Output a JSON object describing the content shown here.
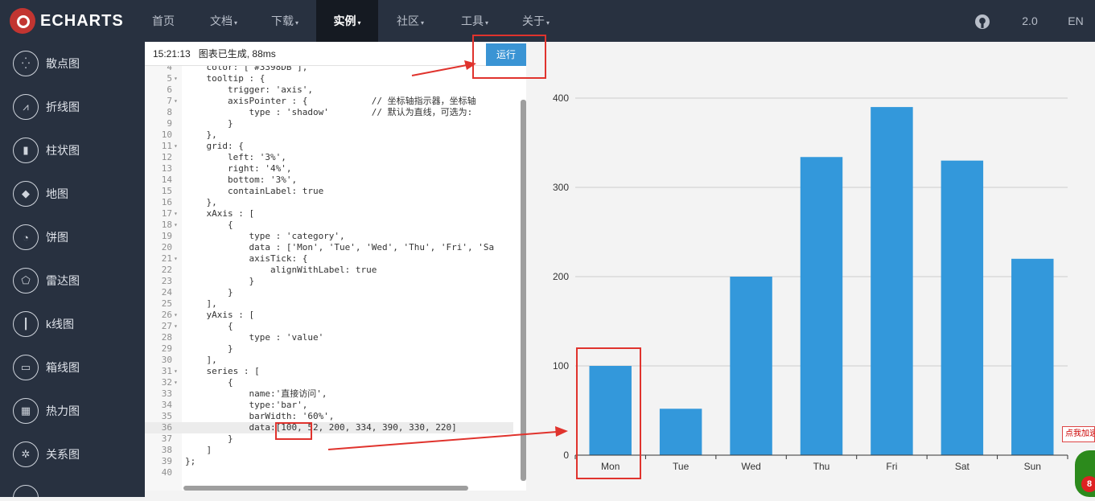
{
  "brand": {
    "name": "ECHARTS"
  },
  "nav": {
    "items": [
      {
        "label": "首页"
      },
      {
        "label": "文档"
      },
      {
        "label": "下载"
      },
      {
        "label": "实例"
      },
      {
        "label": "社区"
      },
      {
        "label": "工具"
      },
      {
        "label": "关于"
      }
    ],
    "version": "2.0",
    "lang": "EN"
  },
  "sidebar": {
    "items": [
      {
        "label": "散点图",
        "icon": "scatter-icon"
      },
      {
        "label": "折线图",
        "icon": "line-chart-icon"
      },
      {
        "label": "柱状图",
        "icon": "bar-chart-icon"
      },
      {
        "label": "地图",
        "icon": "map-icon"
      },
      {
        "label": "饼图",
        "icon": "pie-chart-icon"
      },
      {
        "label": "雷达图",
        "icon": "radar-chart-icon"
      },
      {
        "label": "k线图",
        "icon": "candlestick-icon"
      },
      {
        "label": "箱线图",
        "icon": "boxplot-icon"
      },
      {
        "label": "热力图",
        "icon": "heatmap-icon"
      },
      {
        "label": "关系图",
        "icon": "graph-icon"
      }
    ]
  },
  "editor": {
    "status_time": "15:21:13",
    "status_message": "图表已生成, 88ms",
    "run_label": "运行",
    "active_line": 36,
    "lines": [
      {
        "n": "4",
        "fold": false,
        "text": "    color: ['#3398DB'],"
      },
      {
        "n": "5",
        "fold": true,
        "text": "    tooltip : {"
      },
      {
        "n": "6",
        "fold": false,
        "text": "        trigger: 'axis',"
      },
      {
        "n": "7",
        "fold": true,
        "text": "        axisPointer : {            // 坐标轴指示器，坐标轴"
      },
      {
        "n": "8",
        "fold": false,
        "text": "            type : 'shadow'        // 默认为直线，可选为:"
      },
      {
        "n": "9",
        "fold": false,
        "text": "        }"
      },
      {
        "n": "10",
        "fold": false,
        "text": "    },"
      },
      {
        "n": "11",
        "fold": true,
        "text": "    grid: {"
      },
      {
        "n": "12",
        "fold": false,
        "text": "        left: '3%',"
      },
      {
        "n": "13",
        "fold": false,
        "text": "        right: '4%',"
      },
      {
        "n": "14",
        "fold": false,
        "text": "        bottom: '3%',"
      },
      {
        "n": "15",
        "fold": false,
        "text": "        containLabel: true"
      },
      {
        "n": "16",
        "fold": false,
        "text": "    },"
      },
      {
        "n": "17",
        "fold": true,
        "text": "    xAxis : ["
      },
      {
        "n": "18",
        "fold": true,
        "text": "        {"
      },
      {
        "n": "19",
        "fold": false,
        "text": "            type : 'category',"
      },
      {
        "n": "20",
        "fold": false,
        "text": "            data : ['Mon', 'Tue', 'Wed', 'Thu', 'Fri', 'Sa"
      },
      {
        "n": "21",
        "fold": true,
        "text": "            axisTick: {"
      },
      {
        "n": "22",
        "fold": false,
        "text": "                alignWithLabel: true"
      },
      {
        "n": "23",
        "fold": false,
        "text": "            }"
      },
      {
        "n": "24",
        "fold": false,
        "text": "        }"
      },
      {
        "n": "25",
        "fold": false,
        "text": "    ],"
      },
      {
        "n": "26",
        "fold": true,
        "text": "    yAxis : ["
      },
      {
        "n": "27",
        "fold": true,
        "text": "        {"
      },
      {
        "n": "28",
        "fold": false,
        "text": "            type : 'value'"
      },
      {
        "n": "29",
        "fold": false,
        "text": "        }"
      },
      {
        "n": "30",
        "fold": false,
        "text": "    ],"
      },
      {
        "n": "31",
        "fold": true,
        "text": "    series : ["
      },
      {
        "n": "32",
        "fold": true,
        "text": "        {"
      },
      {
        "n": "33",
        "fold": false,
        "text": "            name:'直接访问',"
      },
      {
        "n": "34",
        "fold": false,
        "text": "            type:'bar',"
      },
      {
        "n": "35",
        "fold": false,
        "text": "            barWidth: '60%',"
      },
      {
        "n": "36",
        "fold": false,
        "text": "            data:[100, 52, 200, 334, 390, 330, 220]"
      },
      {
        "n": "37",
        "fold": false,
        "text": "        }"
      },
      {
        "n": "38",
        "fold": false,
        "text": "    ]"
      },
      {
        "n": "39",
        "fold": false,
        "text": "};"
      },
      {
        "n": "40",
        "fold": false,
        "text": ""
      }
    ]
  },
  "chart_data": {
    "type": "bar",
    "categories": [
      "Mon",
      "Tue",
      "Wed",
      "Thu",
      "Fri",
      "Sat",
      "Sun"
    ],
    "values": [
      100,
      52,
      200,
      334,
      390,
      330,
      220
    ],
    "title": "",
    "xlabel": "",
    "ylabel": "",
    "ylim": [
      0,
      400
    ],
    "yticks": [
      0,
      100,
      200,
      300,
      400
    ],
    "grid": true,
    "bar_color": "#3398DB"
  },
  "corner_ad": {
    "label": "点我加速",
    "count": "8"
  },
  "colors": {
    "nav_bg": "#283140",
    "accent": "#3a94d4",
    "annotation": "#e0332d"
  }
}
